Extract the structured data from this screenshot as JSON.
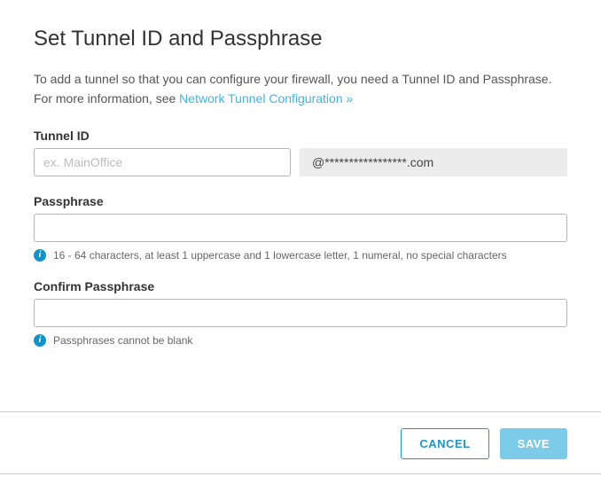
{
  "title": "Set Tunnel ID and Passphrase",
  "description": {
    "text_before_link": "To add a tunnel so that you can configure your firewall, you need a Tunnel ID and Passphrase. For more information, see ",
    "link_text": "Network Tunnel Configuration »"
  },
  "tunnel_id": {
    "label": "Tunnel ID",
    "placeholder": "ex. MainOffice",
    "value": "",
    "domain_suffix": "@*****************.com"
  },
  "passphrase": {
    "label": "Passphrase",
    "value": "",
    "hint": "16 - 64 characters, at least 1 uppercase and 1 lowercase letter, 1 numeral, no special characters"
  },
  "confirm_passphrase": {
    "label": "Confirm Passphrase",
    "value": "",
    "hint": "Passphrases cannot be blank"
  },
  "buttons": {
    "cancel": "CANCEL",
    "save": "SAVE"
  },
  "info_icon_glyph": "i"
}
